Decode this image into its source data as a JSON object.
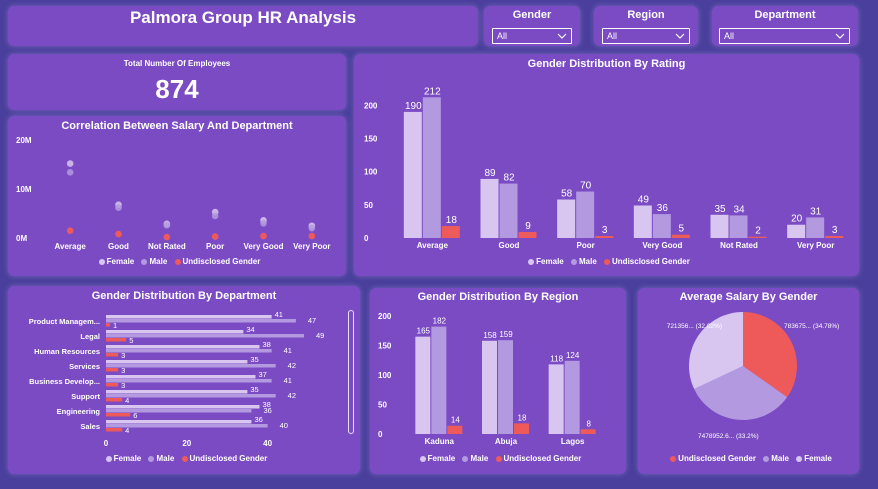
{
  "header": {
    "title": "Palmora Group HR Analysis"
  },
  "slicers": [
    {
      "label": "Gender",
      "value": "All"
    },
    {
      "label": "Region",
      "value": "All"
    },
    {
      "label": "Department",
      "value": "All"
    }
  ],
  "kpi": {
    "label": "Total Number Of Employees",
    "value": "874"
  },
  "colors": {
    "female": "#d8c6f0",
    "male": "#b39ae0",
    "undisclosed": "#ee5a5a",
    "panel": "#7b4bc4",
    "background": "#4a3f9c"
  },
  "legend_labels": {
    "female": "Female",
    "male": "Male",
    "undisclosed": "Undisclosed Gender"
  },
  "charts": {
    "salary_dept": {
      "title": "Correlation Between Salary And Department"
    },
    "rating": {
      "title": "Gender Distribution By Rating"
    },
    "department": {
      "title": "Gender Distribution By Department"
    },
    "region": {
      "title": "Gender Distribution By Region"
    },
    "avg_salary": {
      "title": "Average Salary By Gender"
    }
  },
  "chart_data": [
    {
      "type": "scatter",
      "title": "Correlation Between Salary And Department",
      "categories": [
        "Average",
        "Good",
        "Not Rated",
        "Poor",
        "Very Good",
        "Very Poor"
      ],
      "y_ticks": [
        "0M",
        "10M",
        "20M"
      ],
      "ylim": [
        0,
        20
      ],
      "series": [
        {
          "name": "Female",
          "values": [
            15.2,
            6.8,
            2.9,
            5.3,
            3.6,
            2.5
          ]
        },
        {
          "name": "Male",
          "values": [
            13.4,
            6.2,
            2.6,
            4.5,
            3.0,
            2.0
          ]
        },
        {
          "name": "Undisclosed Gender",
          "values": [
            1.5,
            0.8,
            0.2,
            0.3,
            0.4,
            0.4
          ]
        }
      ]
    },
    {
      "type": "bar",
      "title": "Gender Distribution By Rating",
      "categories": [
        "Average",
        "Good",
        "Poor",
        "Very Good",
        "Not Rated",
        "Very Poor"
      ],
      "y_ticks": [
        "0",
        "50",
        "100",
        "150",
        "200"
      ],
      "ylim": [
        0,
        220
      ],
      "series": [
        {
          "name": "Female",
          "values": [
            190,
            89,
            58,
            49,
            35,
            20
          ]
        },
        {
          "name": "Male",
          "values": [
            212,
            82,
            70,
            36,
            34,
            31
          ]
        },
        {
          "name": "Undisclosed Gender",
          "values": [
            18,
            9,
            3,
            5,
            2,
            3
          ]
        }
      ]
    },
    {
      "type": "bar",
      "orientation": "horizontal",
      "title": "Gender Distribution By Department",
      "categories": [
        "Product Managem...",
        "Legal",
        "Human Resources",
        "Services",
        "Business Develop...",
        "Support",
        "Engineering",
        "Sales"
      ],
      "x_ticks": [
        "0",
        "20",
        "40"
      ],
      "xlim": [
        0,
        50
      ],
      "series": [
        {
          "name": "Female",
          "values": [
            41,
            34,
            38,
            35,
            37,
            35,
            38,
            36
          ]
        },
        {
          "name": "Male",
          "values": [
            47,
            49,
            41,
            42,
            41,
            42,
            36,
            40
          ]
        },
        {
          "name": "Undisclosed Gender",
          "values": [
            1,
            5,
            3,
            3,
            3,
            4,
            6,
            4
          ]
        }
      ]
    },
    {
      "type": "bar",
      "title": "Gender Distribution By Region",
      "categories": [
        "Kaduna",
        "Abuja",
        "Lagos"
      ],
      "y_ticks": [
        "0",
        "50",
        "100",
        "150",
        "200"
      ],
      "ylim": [
        0,
        200
      ],
      "series": [
        {
          "name": "Female",
          "values": [
            165,
            158,
            118
          ]
        },
        {
          "name": "Male",
          "values": [
            182,
            159,
            124
          ]
        },
        {
          "name": "Undisclosed Gender",
          "values": [
            14,
            18,
            8
          ]
        }
      ]
    },
    {
      "type": "pie",
      "title": "Average Salary By Gender",
      "slices": [
        {
          "name": "Undisclosed Gender",
          "share": 34.78,
          "label": "783675... (34.78%)"
        },
        {
          "name": "Male",
          "share": 33.2,
          "label": "7478952.6... (33.2%)"
        },
        {
          "name": "Female",
          "share": 32.02,
          "label": "721356... (32.02%)"
        }
      ],
      "legend": [
        "Undisclosed Gender",
        "Male",
        "Female"
      ]
    }
  ]
}
